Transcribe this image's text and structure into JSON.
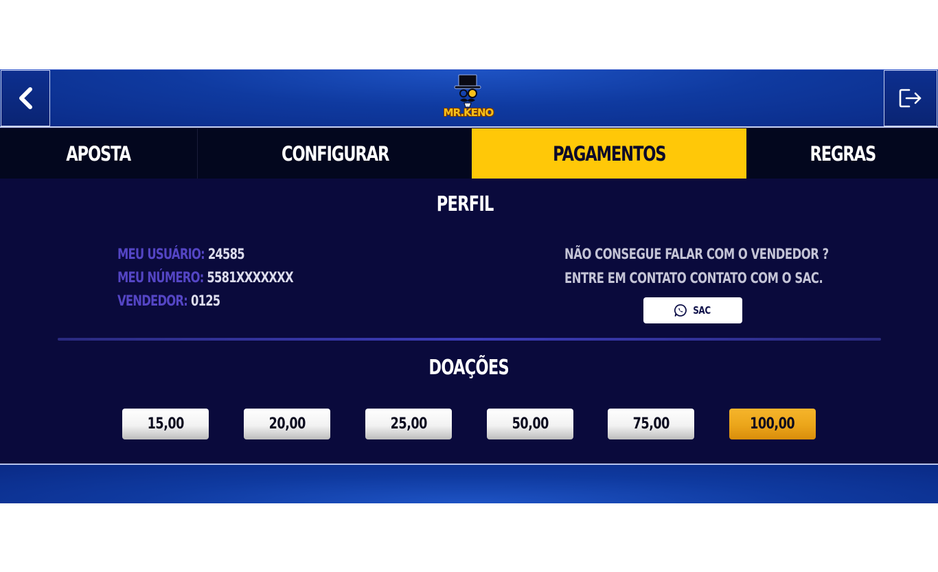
{
  "header": {
    "logo_text": "MR.KENO",
    "back_icon": "chevron-left-icon",
    "exit_icon": "logout-icon"
  },
  "tabs": [
    {
      "label": "APOSTA",
      "active": false
    },
    {
      "label": "CONFIGURAR",
      "active": false
    },
    {
      "label": "PAGAMENTOS",
      "active": true
    },
    {
      "label": "REGRAS",
      "active": false
    }
  ],
  "perfil": {
    "title": "PERFIL",
    "usuario_label": "MEU USUÁRIO:",
    "usuario_value": "24585",
    "numero_label": "MEU NÚMERO:",
    "numero_value": "5581XXXXXXX",
    "vendedor_label": "VENDEDOR:",
    "vendedor_value": "0125",
    "sac_line1": "NÃO CONSEGUE FALAR COM O VENDEDOR ?",
    "sac_line2": "ENTRE EM CONTATO CONTATO COM O SAC.",
    "sac_button": "SAC",
    "sac_icon": "whatsapp-icon"
  },
  "doacoes": {
    "title": "DOAÇÕES",
    "amounts": [
      "15,00",
      "20,00",
      "25,00",
      "50,00",
      "75,00",
      "100,00"
    ],
    "selected": "100,00"
  },
  "colors": {
    "background": "#0a0a3c",
    "active_tab": "#ffc808",
    "label": "#5445c4",
    "selected_amount": "#eba51a"
  }
}
